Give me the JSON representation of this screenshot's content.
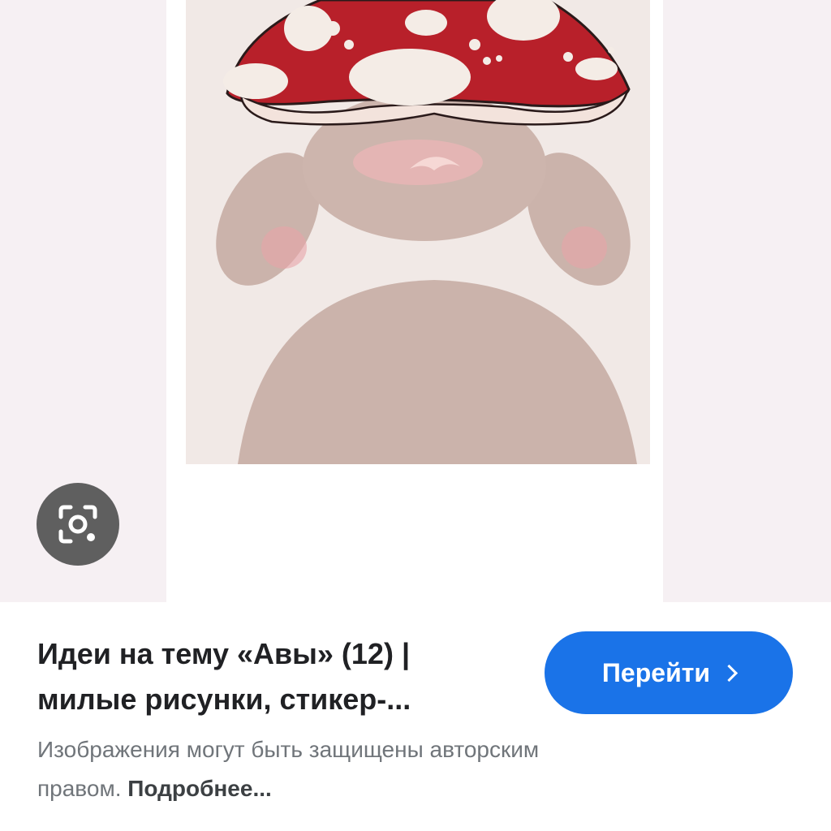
{
  "result": {
    "title_line1": "Идеи на тему «Авы» (12) |",
    "title_line2": "милые рисунки, стикер-...",
    "visit_button_label": "Перейти",
    "disclaimer_text": "Изображения могут быть защищены авторским",
    "disclaimer_line2": "правом. ",
    "learn_more_label": "Подробнее..."
  },
  "icons": {
    "lens": "google-lens-icon",
    "chevron": "chevron-right-icon"
  },
  "colors": {
    "accent": "#1a73e8",
    "viewer_bg": "#f6f0f3",
    "cap_red": "#b8202a",
    "body_beige": "#c9b1a9"
  }
}
